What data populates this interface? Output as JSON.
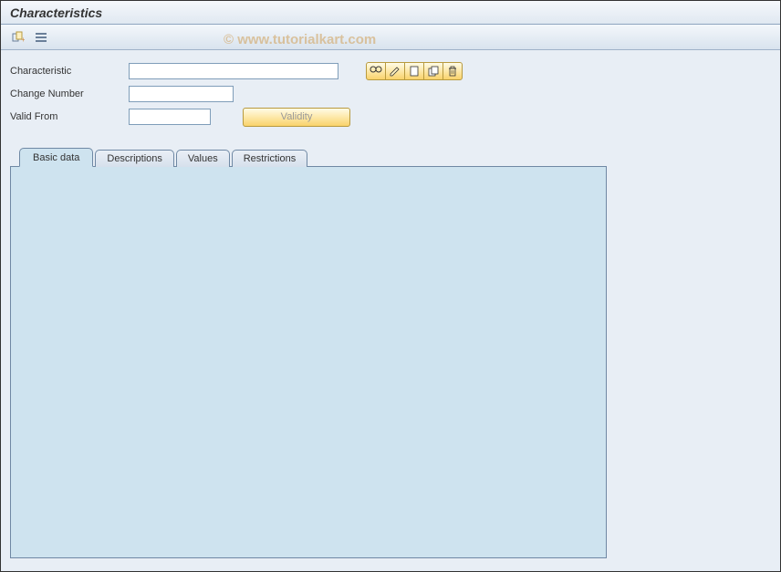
{
  "title": "Characteristics",
  "watermark": "© www.tutorialkart.com",
  "toolbar": {
    "btn1_name": "extend-icon",
    "btn2_name": "structure-icon"
  },
  "form": {
    "characteristic": {
      "label": "Characteristic",
      "value": ""
    },
    "change_number": {
      "label": "Change Number",
      "value": ""
    },
    "valid_from": {
      "label": "Valid From",
      "value": ""
    }
  },
  "action_icons": {
    "display": "display-icon",
    "change": "change-icon",
    "create": "create-icon",
    "copy": "copy-icon",
    "delete": "delete-icon"
  },
  "validity_button": {
    "label": "Validity"
  },
  "tabs": [
    {
      "label": "Basic data",
      "active": true
    },
    {
      "label": "Descriptions",
      "active": false
    },
    {
      "label": "Values",
      "active": false
    },
    {
      "label": "Restrictions",
      "active": false
    }
  ]
}
